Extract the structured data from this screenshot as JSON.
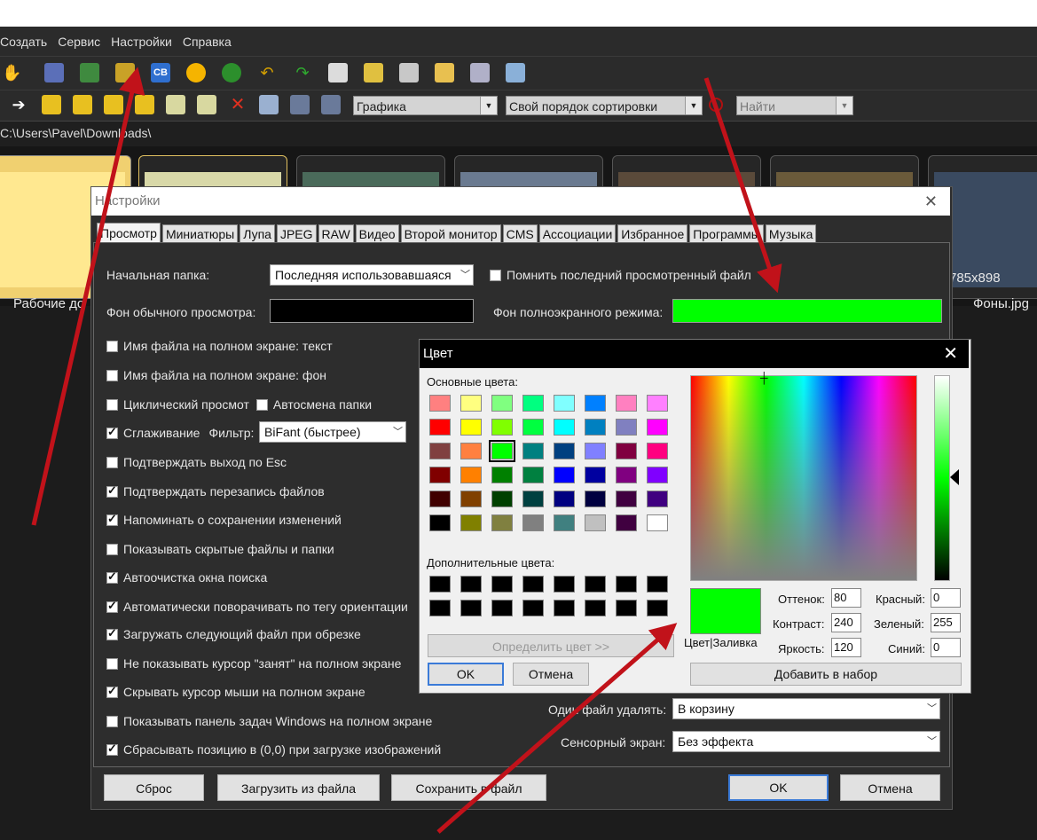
{
  "menu": [
    "Создать",
    "Сервис",
    "Настройки",
    "Справка"
  ],
  "toolbar2": {
    "filter_combo": "Графика",
    "sort_combo": "Свой порядок сортировки",
    "search_combo": "Найти"
  },
  "path": "C:\\Users\\Pavel\\Downloads\\",
  "thumbs": {
    "left_label": "Рабочие до",
    "right_label": "Фоны.jpg",
    "right_size": "785x898"
  },
  "settings": {
    "title": "Настройки",
    "tabs": [
      "Просмотр",
      "Миниатюры",
      "Лупа",
      "JPEG",
      "RAW",
      "Видео",
      "Второй монитор",
      "CMS",
      "Ассоциации",
      "Избранное",
      "Программы",
      "Музыка"
    ],
    "start_folder_label": "Начальная папка:",
    "start_folder_value": "Последняя использовавшаяся",
    "remember_last_label": "Помнить последний просмотренный файл",
    "normal_bg_label": "Фон обычного просмотра:",
    "fullscreen_bg_label": "Фон полноэкранного режима:",
    "fullscreen_bg_color": "#00ff00",
    "checkboxes": [
      {
        "label": "Имя файла на полном экране: текст",
        "checked": false
      },
      {
        "label": "Имя файла на полном экране: фон",
        "checked": false
      },
      {
        "label": "Циклический просмот",
        "checked": false
      },
      {
        "label": "Сглаживание",
        "checked": true
      },
      {
        "label": "Подтверждать выход по Esc",
        "checked": false
      },
      {
        "label": "Подтверждать перезапись файлов",
        "checked": true
      },
      {
        "label": "Напоминать о сохранении изменений",
        "checked": true
      },
      {
        "label": "Показывать скрытые файлы и папки",
        "checked": false
      },
      {
        "label": "Автоочистка окна поиска",
        "checked": true
      },
      {
        "label": "Автоматически поворачивать по тегу ориентации",
        "checked": true
      },
      {
        "label": "Загружать следующий файл при обрезке",
        "checked": true
      },
      {
        "label": "Не показывать курсор \"занят\" на полном экране",
        "checked": false
      },
      {
        "label": "Скрывать курсор мыши на полном экране",
        "checked": true
      },
      {
        "label": "Показывать панель задач Windows на полном экране",
        "checked": false
      },
      {
        "label": "Сбрасывать позицию в (0,0) при загрузке изображений",
        "checked": true
      }
    ],
    "auto_folder_label": "Автосмена папки",
    "filter_label": "Фильтр:",
    "filter_value": "BiFant (быстрее)",
    "delete_label": "Один файл удалять:",
    "delete_value": "В корзину",
    "touch_label": "Сенсорный экран:",
    "touch_value": "Без эффекта",
    "buttons": {
      "reset": "Сброс",
      "load": "Загрузить из файла",
      "save": "Сохранить в файл",
      "ok": "OK",
      "cancel": "Отмена"
    }
  },
  "color_dialog": {
    "title": "Цвет",
    "basic_label": "Основные цвета:",
    "custom_label": "Дополнительные цвета:",
    "define_button": "Определить цвет >>",
    "ok": "OK",
    "cancel": "Отмена",
    "add_button": "Добавить в набор",
    "preview_label": "Цвет|Заливка",
    "preview_color": "#00ff00",
    "hue_label": "Оттенок:",
    "hue": "80",
    "sat_label": "Контраст:",
    "sat": "240",
    "lum_label": "Яркость:",
    "lum": "120",
    "red_label": "Красный:",
    "red": "0",
    "green_label": "Зеленый:",
    "green": "255",
    "blue_label": "Синий:",
    "blue": "0",
    "basic_colors": [
      [
        "#ff8080",
        "#ffff80",
        "#80ff80",
        "#00ff80",
        "#80ffff",
        "#0080ff",
        "#ff80c0",
        "#ff80ff"
      ],
      [
        "#ff0000",
        "#ffff00",
        "#80ff00",
        "#00ff40",
        "#00ffff",
        "#0080c0",
        "#8080c0",
        "#ff00ff"
      ],
      [
        "#804040",
        "#ff8040",
        "#00ff00",
        "#008080",
        "#004080",
        "#8080ff",
        "#800040",
        "#ff0080"
      ],
      [
        "#800000",
        "#ff8000",
        "#008000",
        "#008040",
        "#0000ff",
        "#0000a0",
        "#800080",
        "#8000ff"
      ],
      [
        "#400000",
        "#804000",
        "#004000",
        "#004040",
        "#000080",
        "#000040",
        "#400040",
        "#400080"
      ],
      [
        "#000000",
        "#808000",
        "#808040",
        "#808080",
        "#408080",
        "#c0c0c0",
        "#400040",
        "#ffffff"
      ]
    ],
    "selected_basic": "#00ff00"
  }
}
